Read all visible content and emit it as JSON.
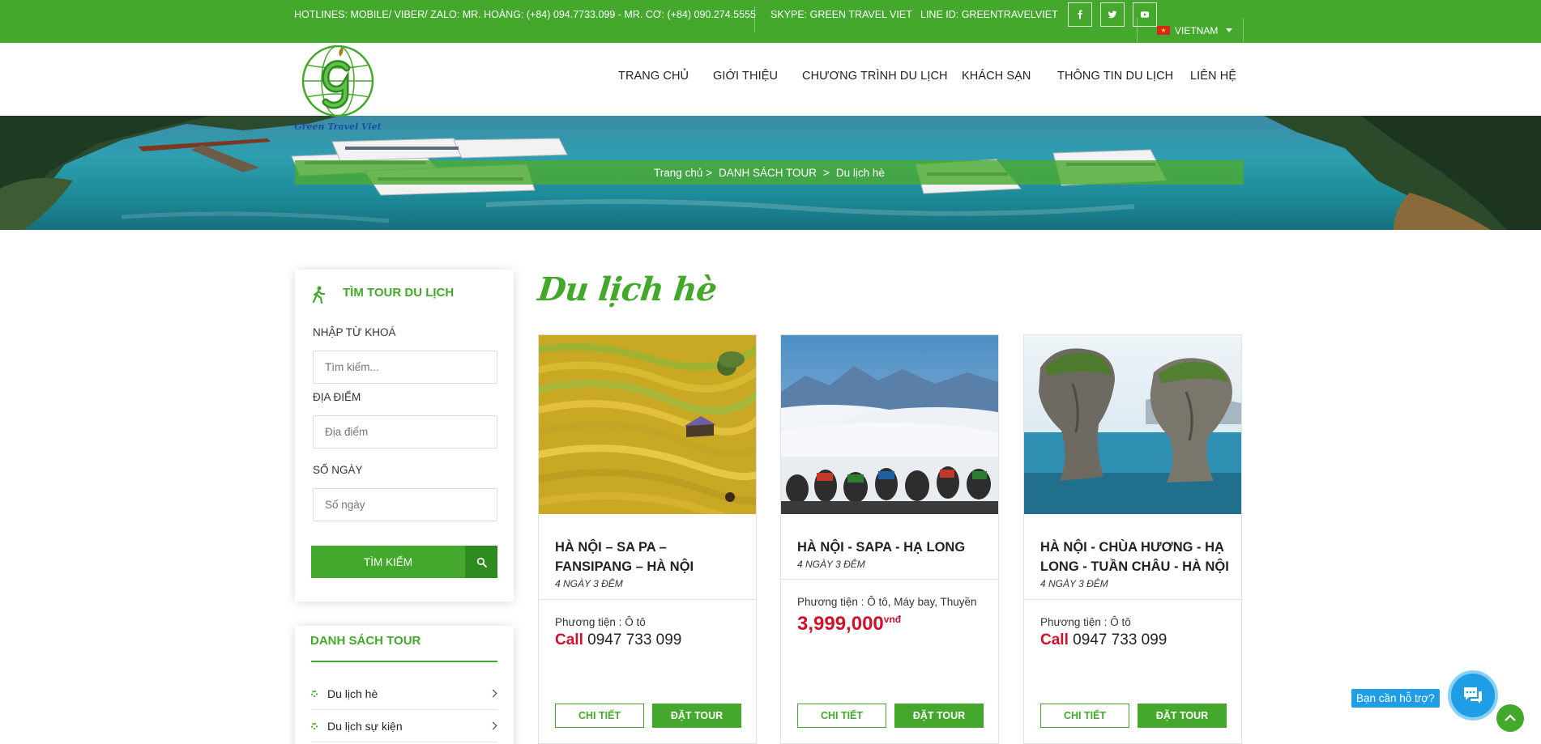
{
  "topbar": {
    "hotline": "HOTLINES: MOBILE/ VIBER/ ZALO: MR. HOÀNG: (+84) 094.7733.099 - MR. CƠ: (+84) 090.274.5555",
    "skype": "SKYPE: GREEN TRAVEL VIET",
    "line_id": "LINE ID: GREENTRAVELVIET",
    "social": [
      "facebook-icon",
      "twitter-icon",
      "youtube-icon"
    ],
    "language": "VIETNAM"
  },
  "header": {
    "logo_text": "Green Travel Viet",
    "nav": [
      "TRANG CHỦ",
      "GIỚI THIỆU",
      "CHƯƠNG TRÌNH DU LỊCH",
      "KHÁCH SẠN",
      "THÔNG TIN DU LỊCH",
      "LIÊN HỆ"
    ]
  },
  "breadcrumb": {
    "home": "Trang chủ >",
    "list": "DANH SÁCH TOUR",
    "sep": ">",
    "current": "Du lịch hè"
  },
  "search": {
    "title": "TÌM TOUR DU LỊCH",
    "keyword_label": "NHẬP TỪ KHOÁ",
    "keyword_placeholder": "Tìm kiếm...",
    "location_label": "ĐỊA ĐIỂM",
    "location_placeholder": "Địa điểm",
    "days_label": "SỐ NGÀY",
    "days_placeholder": "Số ngày",
    "submit": "TÌM KIẾM"
  },
  "tour_list": {
    "title": "DANH SÁCH TOUR",
    "items": [
      "Du lịch hè",
      "Du lịch sự kiện"
    ]
  },
  "main": {
    "title": "Du lịch hè",
    "tours": [
      {
        "name": "HÀ NỘI – SA PA – FANSIPANG – HÀ NỘI",
        "days": "4 NGÀY 3 ĐÊM",
        "transport": "Phương tiện : Ô tô",
        "call_label": "Call",
        "call_number": "0947 733 099",
        "detail": "CHI TIẾT",
        "book": "ĐẶT TOUR"
      },
      {
        "name": "HÀ NỘI - SAPA - HẠ LONG",
        "days": "4 NGÀY 3 ĐÊM",
        "transport": "Phương tiện : Ô tô, Máy bay, Thuyền",
        "price": "3,999,000",
        "currency": "vnđ",
        "detail": "CHI TIẾT",
        "book": "ĐẶT TOUR"
      },
      {
        "name": "HÀ NỘI - CHÙA HƯƠNG - HẠ LONG - TUẦN CHÂU - HÀ NỘI",
        "days": "4 NGÀY 3 ĐÊM",
        "transport": "Phương tiện : Ô tô",
        "call_label": "Call",
        "call_number": "0947 733 099",
        "detail": "CHI TIẾT",
        "book": "ĐẶT TOUR"
      }
    ]
  },
  "floating": {
    "help": "Bạn cần hỗ trợ?"
  }
}
